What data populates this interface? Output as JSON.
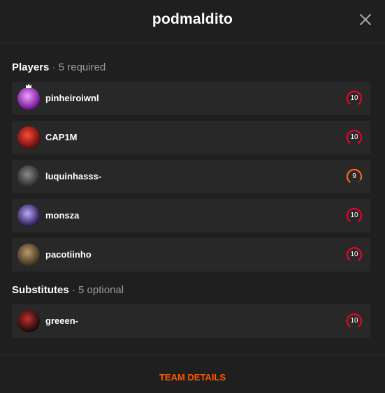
{
  "header": {
    "title": "podmaldito"
  },
  "players_section": {
    "label": "Players",
    "separator": " · ",
    "sub": "5 required"
  },
  "players": [
    {
      "name": "pinheiroiwnl",
      "level": "10",
      "level_fraction": 1.0,
      "level_color": "#e80128",
      "avatar_colors": [
        "#f0a0ff",
        "#6a0a8a"
      ],
      "captain": true
    },
    {
      "name": "CAP1M",
      "level": "10",
      "level_fraction": 1.0,
      "level_color": "#e80128",
      "avatar_colors": [
        "#ff4a3a",
        "#5a0808"
      ],
      "captain": false
    },
    {
      "name": "luquinhasss-",
      "level": "9",
      "level_fraction": 0.9,
      "level_color": "#fe6216",
      "avatar_colors": [
        "#8a8a8a",
        "#202020"
      ],
      "captain": false
    },
    {
      "name": "monsza",
      "level": "10",
      "level_fraction": 1.0,
      "level_color": "#e80128",
      "avatar_colors": [
        "#b8a8ff",
        "#201040"
      ],
      "captain": false
    },
    {
      "name": "pacotiinho",
      "level": "10",
      "level_fraction": 1.0,
      "level_color": "#e80128",
      "avatar_colors": [
        "#b89a70",
        "#3a2a18"
      ],
      "captain": false
    }
  ],
  "subs_section": {
    "label": "Substitutes",
    "separator": " · ",
    "sub": "5 optional"
  },
  "substitutes": [
    {
      "name": "greeen-",
      "level": "10",
      "level_fraction": 1.0,
      "level_color": "#e80128",
      "avatar_colors": [
        "#c03030",
        "#100808"
      ],
      "captain": false
    }
  ],
  "footer": {
    "team_details_label": "TEAM DETAILS"
  },
  "colors": {
    "accent": "#ff5500",
    "background": "#1f1f1f",
    "row": "#282828"
  },
  "icons": {
    "close": "close-icon",
    "crown": "crown-icon",
    "level": "skill-level-icon"
  }
}
